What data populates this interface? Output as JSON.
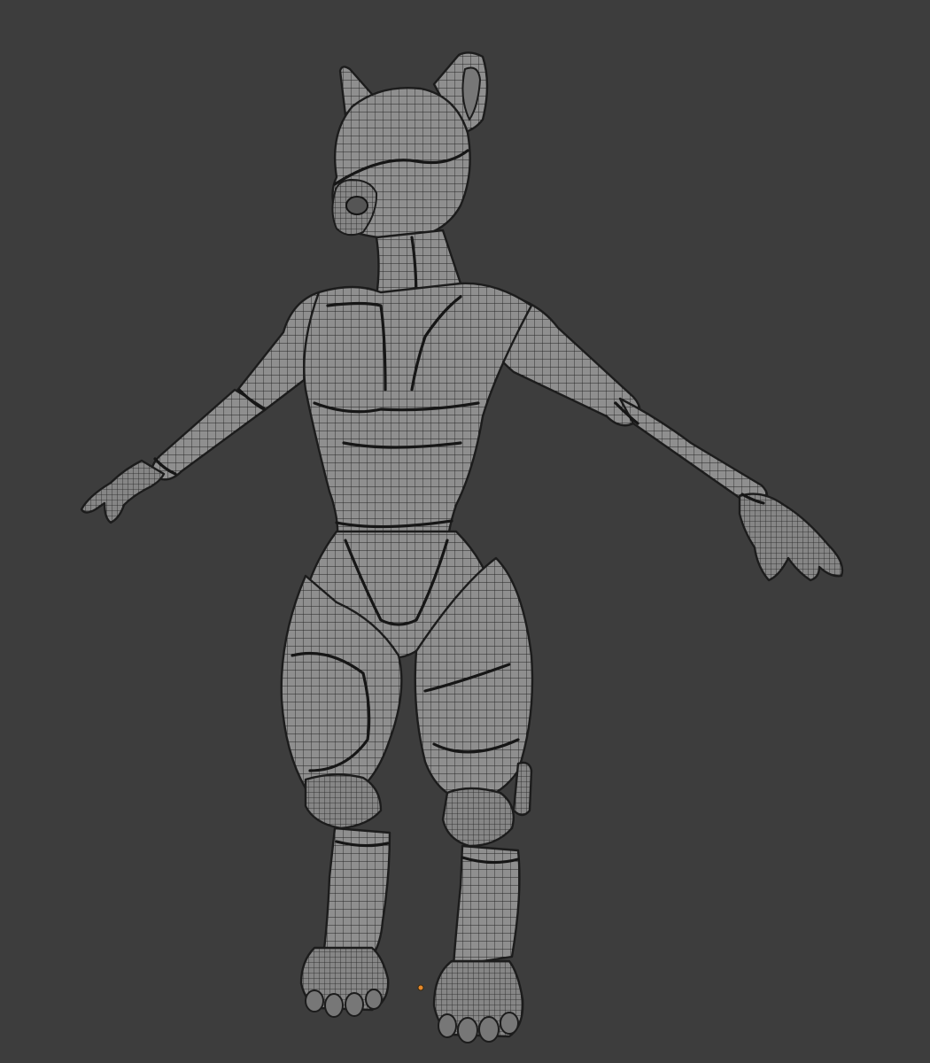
{
  "viewport": {
    "background_color": "#3d3d3d",
    "mesh_color": "#8f8f8f",
    "wire_color": "#1c1c1c",
    "origin_color": "#e8892a"
  }
}
